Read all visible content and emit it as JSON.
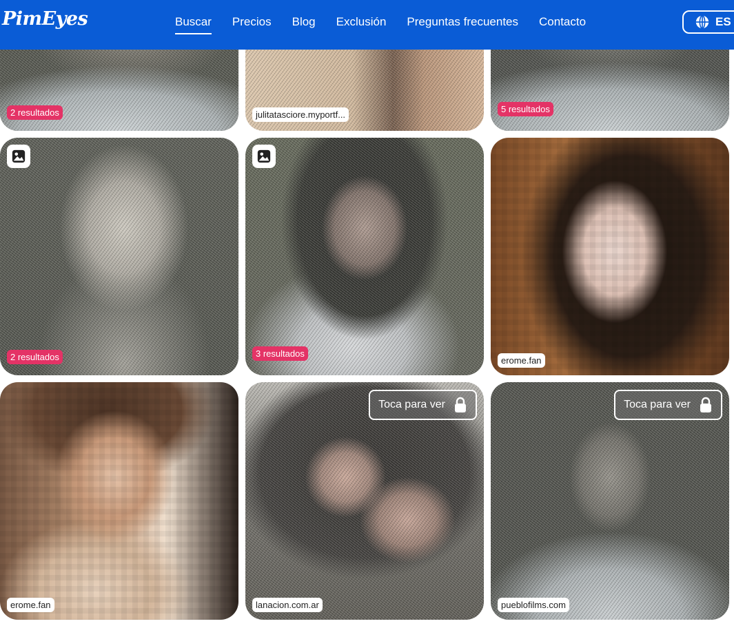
{
  "header": {
    "logo": "PimEyes",
    "nav": [
      {
        "label": "Buscar",
        "active": true
      },
      {
        "label": "Precios"
      },
      {
        "label": "Blog"
      },
      {
        "label": "Exclusión"
      },
      {
        "label": "Preguntas frecuentes"
      },
      {
        "label": "Contacto"
      }
    ],
    "language": "ES",
    "language_icon": "globe-icon"
  },
  "colors": {
    "header": "#0a5cd6",
    "badge": "#e43366"
  },
  "results": [
    {
      "badge": "2 resultados"
    },
    {
      "domain": "julitatasciore.myportf..."
    },
    {
      "badge": "5 resultados"
    },
    {
      "badge": "2 resultados",
      "icon": "image-icon"
    },
    {
      "badge": "3 resultados",
      "icon": "image-icon"
    },
    {
      "domain": "erome.fan"
    },
    {
      "domain": "erome.fan"
    },
    {
      "domain": "lanacion.com.ar",
      "tap_label": "Toca para ver",
      "tap_icon": "lock-icon"
    },
    {
      "domain": "pueblofilms.com",
      "tap_label": "Toca para ver",
      "tap_icon": "lock-icon"
    }
  ]
}
